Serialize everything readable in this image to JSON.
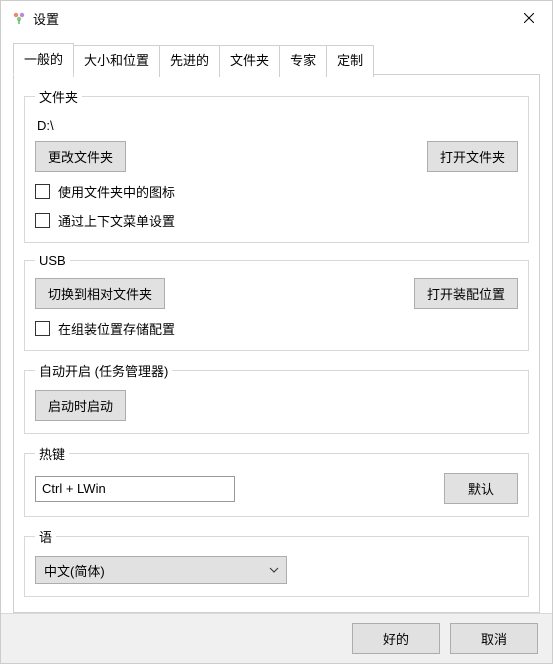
{
  "window": {
    "title": "设置"
  },
  "tabs": [
    {
      "label": "一般的"
    },
    {
      "label": "大小和位置"
    },
    {
      "label": "先进的"
    },
    {
      "label": "文件夹"
    },
    {
      "label": "专家"
    },
    {
      "label": "定制"
    }
  ],
  "folder_group": {
    "legend": "文件夹",
    "path": "D:\\",
    "change_btn": "更改文件夹",
    "open_btn": "打开文件夹",
    "icons_checkbox": "使用文件夹中的图标",
    "context_checkbox": "通过上下文菜单设置"
  },
  "usb_group": {
    "legend": "USB",
    "switch_btn": "切换到相对文件夹",
    "open_btn": "打开装配位置",
    "store_checkbox": "在组装位置存储配置"
  },
  "autostart_group": {
    "legend": "自动开启 (任务管理器)",
    "start_btn": "启动时启动"
  },
  "hotkey_group": {
    "legend": "热键",
    "value": "Ctrl + LWin",
    "default_btn": "默认"
  },
  "language_group": {
    "legend": "语",
    "selected": "中文(简体)"
  },
  "footer": {
    "ok": "好的",
    "cancel": "取消"
  }
}
